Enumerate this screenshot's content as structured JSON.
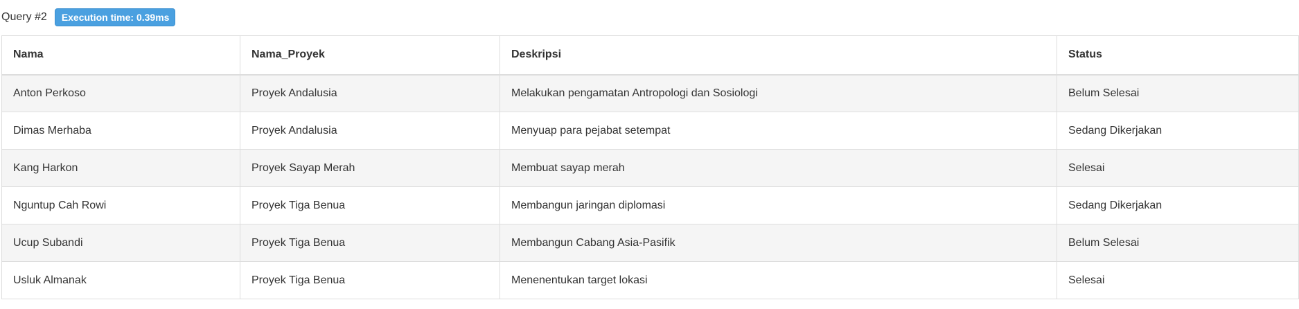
{
  "query": {
    "label": "Query #2",
    "execution_badge": "Execution time: 0.39ms"
  },
  "table": {
    "columns": [
      "Nama",
      "Nama_Proyek",
      "Deskripsi",
      "Status"
    ],
    "rows": [
      [
        "Anton Perkoso",
        "Proyek Andalusia",
        "Melakukan pengamatan Antropologi dan Sosiologi",
        "Belum Selesai"
      ],
      [
        "Dimas Merhaba",
        "Proyek Andalusia",
        "Menyuap para pejabat setempat",
        "Sedang Dikerjakan"
      ],
      [
        "Kang Harkon",
        "Proyek Sayap Merah",
        "Membuat sayap merah",
        "Selesai"
      ],
      [
        "Nguntup Cah Rowi",
        "Proyek Tiga Benua",
        "Membangun jaringan diplomasi",
        "Sedang Dikerjakan"
      ],
      [
        "Ucup Subandi",
        "Proyek Tiga Benua",
        "Membangun Cabang Asia-Pasifik",
        "Belum Selesai"
      ],
      [
        "Usluk Almanak",
        "Proyek Tiga Benua",
        "Menenentukan target lokasi",
        "Selesai"
      ]
    ]
  },
  "colors": {
    "badge_bg": "#4aa0e0",
    "stripe_bg": "#f5f5f5",
    "border": "#dddddd",
    "text": "#333333"
  }
}
